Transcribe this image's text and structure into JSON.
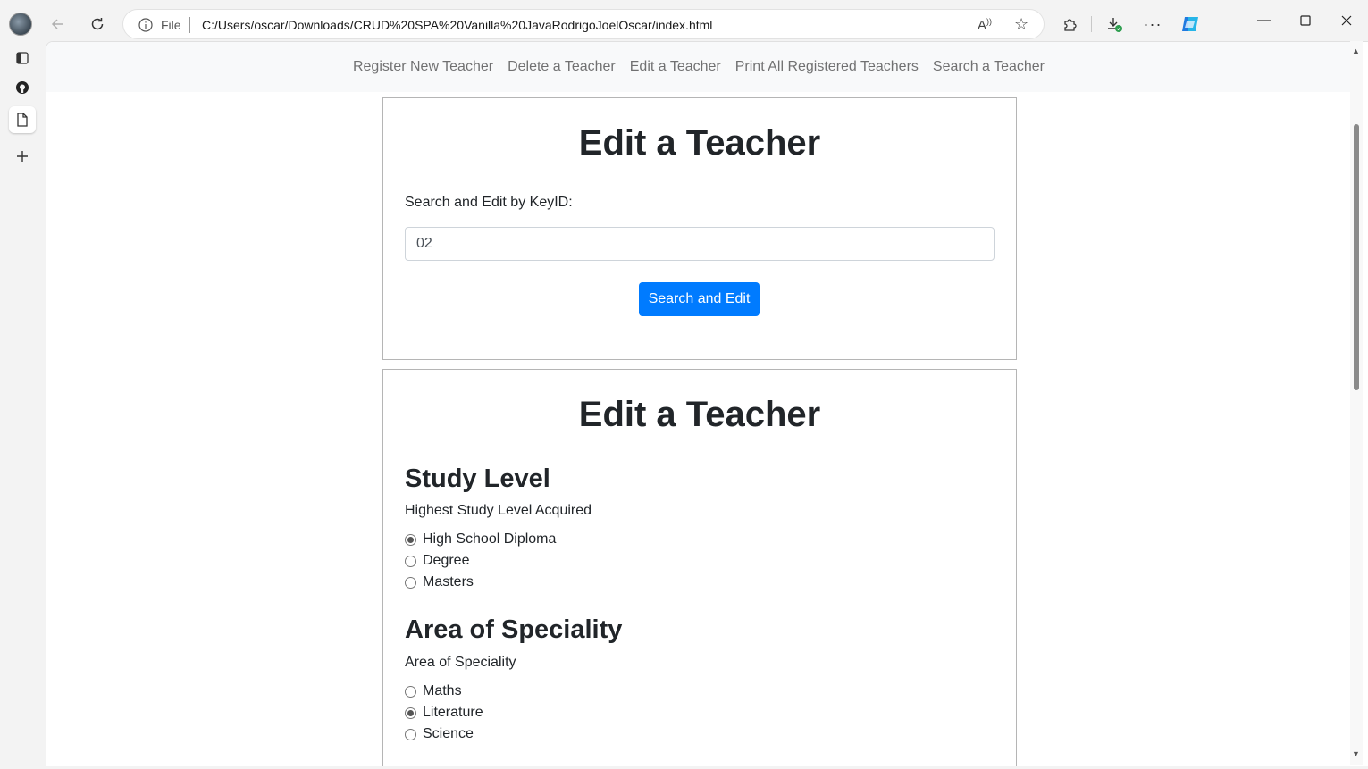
{
  "browser": {
    "address_prefix": "File",
    "url": "C:/Users/oscar/Downloads/CRUD%20SPA%20Vanilla%20JavaRodrigoJoelOscar/index.html"
  },
  "nav": {
    "links": [
      "Register New Teacher",
      "Delete a Teacher",
      "Edit a Teacher",
      "Print All Registered Teachers",
      "Search a Teacher"
    ]
  },
  "search_card": {
    "title": "Edit a Teacher",
    "label": "Search and Edit by KeyID:",
    "input_value": "02",
    "button_label": "Search and Edit"
  },
  "edit_card": {
    "title": "Edit a Teacher",
    "study_level": {
      "heading": "Study Level",
      "label": "Highest Study Level Acquired",
      "options": [
        "High School Diploma",
        "Degree",
        "Masters"
      ],
      "selected": "High School Diploma"
    },
    "speciality": {
      "heading": "Area of Speciality",
      "label": "Area of Speciality",
      "options": [
        "Maths",
        "Literature",
        "Science"
      ],
      "selected": "Literature"
    }
  }
}
